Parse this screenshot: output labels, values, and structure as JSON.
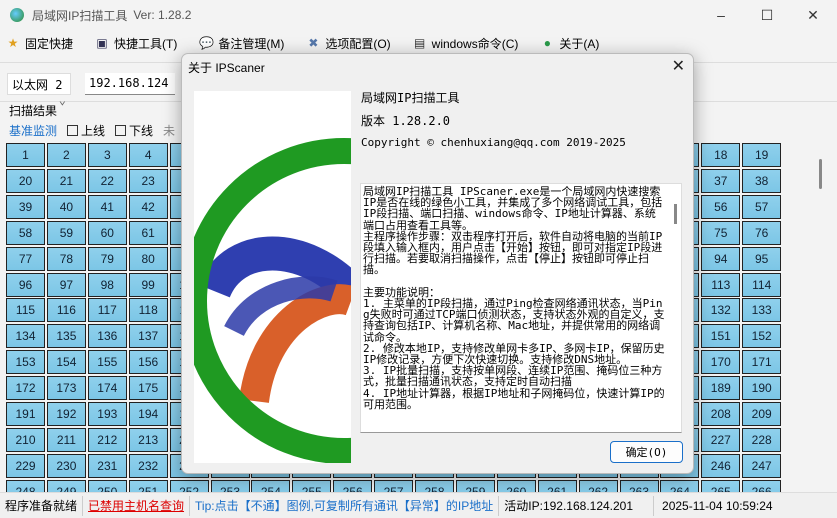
{
  "window": {
    "title": "局域网IP扫描工具",
    "version": "Ver: 1.28.2",
    "minimize": "–",
    "maximize": "☐",
    "close": "✕"
  },
  "menu": [
    {
      "label": "固定快捷",
      "icon": "star-icon",
      "glyph": "★",
      "color": "#e0a020"
    },
    {
      "label": "快捷工具(T)",
      "icon": "tools-window-icon",
      "glyph": "▣",
      "color": "#335"
    },
    {
      "label": "备注管理(M)",
      "icon": "speech-bubble-icon",
      "glyph": "💬",
      "color": "#3a9ad9"
    },
    {
      "label": "选项配置(O)",
      "icon": "wrench-icon",
      "glyph": "✖",
      "color": "#5577aa"
    },
    {
      "label": "windows命令(C)",
      "icon": "terminal-icon",
      "glyph": "▤",
      "color": "#333"
    },
    {
      "label": "关于(A)",
      "icon": "globe-icon",
      "glyph": "●",
      "color": "#2a9a4a"
    }
  ],
  "toolbar": {
    "adapter": "以太网 2",
    "ip_prefix": "192.168.124"
  },
  "scan": {
    "group_label": "扫描结果",
    "baseline_link": "基准监测",
    "online_label": "上线",
    "offline_label": "下线",
    "more_label": "未"
  },
  "scan_grid": {
    "columns": 19,
    "first": 1,
    "last": 266,
    "cell_color": "#86cbe9"
  },
  "status": {
    "ready": "程序准备就绪",
    "hostname_disabled": "已禁用主机名查询",
    "tip": "Tip:点击【不通】图例,可复制所有通讯【异常】的IP地址",
    "active_ip": "活动IP:192.168.124.201",
    "datetime": "2025-11-04 10:59:24"
  },
  "about": {
    "title": "关于 IPScaner",
    "close": "✕",
    "app_name": "局域网IP扫描工具",
    "version": "版本 1.28.2.0",
    "copyright": "Copyright © chenhuxiang@qq.com 2019-2025",
    "description": "局域网IP扫描工具 IPScaner.exe是一个局域网内快速搜索IP是否在线的绿色小工具，并集成了多个网络调试工具，包括IP段扫描、端口扫描、windows命令、IP地址计算器、系统端口占用查看工具等。\n主程序操作步骤：双击程序打开后，软件自动将电脑的当前IP段填入输入框内，用户点击【开始】按钮，即可对指定IP段进行扫描。若要取消扫描操作，点击【停止】按钮即可停止扫描。\n\n主要功能说明：\n1. 主菜单的IP段扫描，通过Ping检查网络通讯状态，当Ping失败时可通过TCP端口侦测状态，支持状态外观的自定义，支持查询包括IP、计算机名称、Mac地址，并提供常用的网络调试命令。\n2. 修改本地IP，支持修改单网卡多IP、多网卡IP，保留历史IP修改记录，方便下次快速切换。支持修改DNS地址。\n3. IP批量扫描，支持按单网段、连续IP范围、掩码位三种方式，批量扫描通讯状态，支持定时自动扫描\n4. IP地址计算器，根据IP地址和子网掩码位，快速计算IP的可用范围。",
    "ok_button": "确定(O)",
    "accent": "#1a6fc9"
  }
}
